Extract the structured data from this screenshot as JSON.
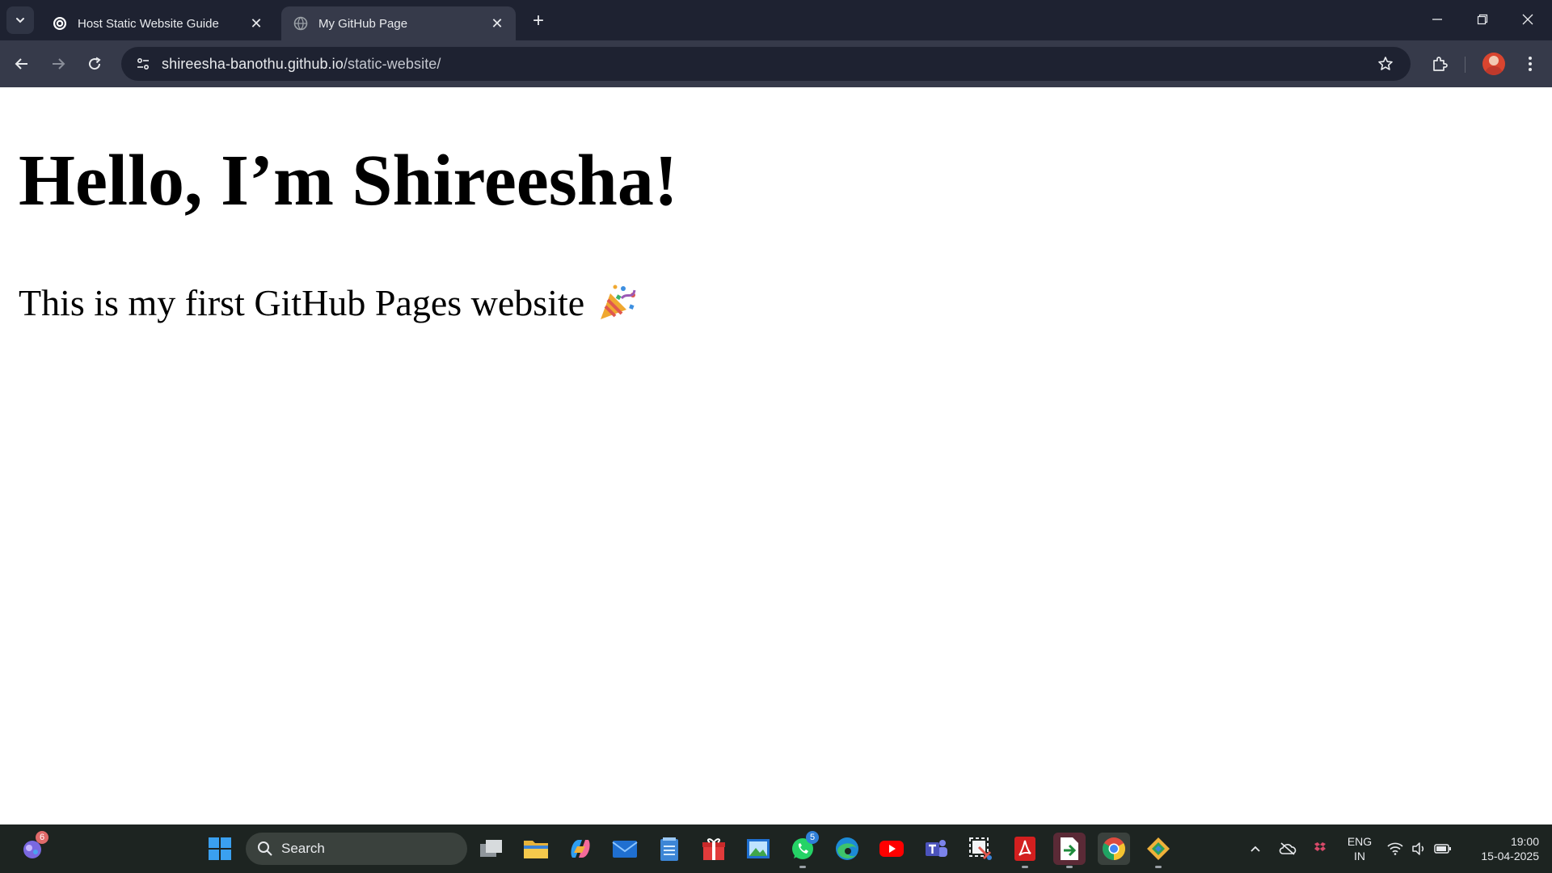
{
  "browser": {
    "tabs": [
      {
        "title": "Host Static Website Guide",
        "icon": "chatgpt-icon",
        "active": false
      },
      {
        "title": "My GitHub Page",
        "icon": "globe-icon",
        "active": true
      }
    ],
    "url": {
      "host": "shireesha-banothu.github.io",
      "path": "/static-website/"
    },
    "theme": {
      "frame": "#1e2231",
      "toolbar": "#363a4a"
    }
  },
  "page": {
    "heading": "Hello, I’m Shireesha!",
    "text": "This is my first GitHub Pages website"
  },
  "taskbar": {
    "search_placeholder": "Search",
    "widgets_badge": "6",
    "whatsapp_badge": "5",
    "language": {
      "line1": "ENG",
      "line2": "IN"
    },
    "time": "19:00",
    "date": "15-04-2025"
  }
}
